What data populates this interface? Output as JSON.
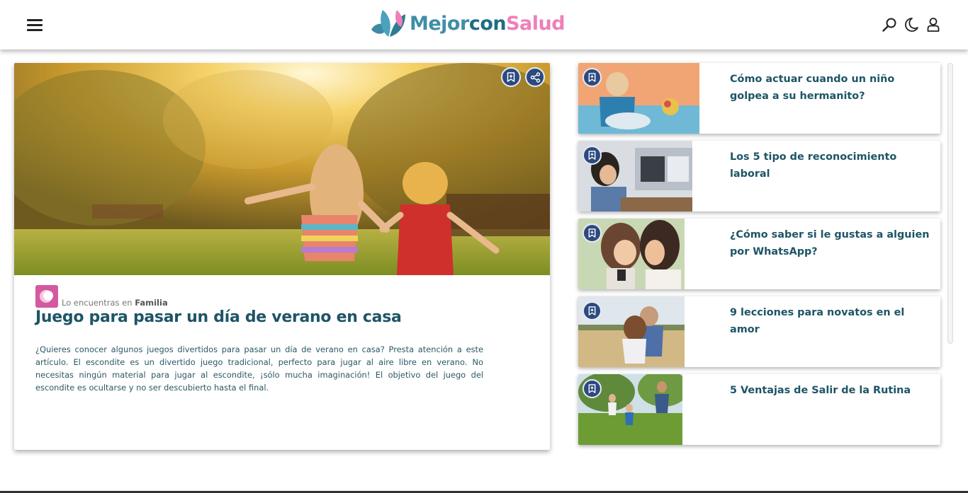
{
  "header": {
    "logo": {
      "part1": "Mejor",
      "part2": "con",
      "part3": "Salud"
    },
    "icons": [
      "search-icon",
      "moon-icon",
      "user-icon"
    ]
  },
  "feature": {
    "category_prefix": "Lo encuentras en",
    "category": "Familia",
    "title": "Juego para pasar un día de verano en casa",
    "description": "¿Quieres conocer algunos juegos divertidos para pasar un día de verano en casa? Presta atención a este artículo. El escondite es un divertido juego tradicional, perfecto para jugar al aire libre en verano. No necesitas ningún material para jugar al escondite, ¡sólo mucha imaginación! El objetivo del juego del escondite es ocultarse y no ser descubierto hasta el final.",
    "image_description": "two girls running in sunny park"
  },
  "side_articles": [
    {
      "title": "Cómo actuar cuando un niño golpea a su hermanito?"
    },
    {
      "title": "Los 5 tipo de reconocimiento laboral"
    },
    {
      "title": "¿Cómo saber si le gustas a alguien por WhatsApp?"
    },
    {
      "title": "9 lecciones para novatos en el amor"
    },
    {
      "title": "5 Ventajas de Salir de la Rutina"
    }
  ],
  "colors": {
    "title": "#1d5566",
    "button": "#2c4a7f",
    "logo_blue": "#3f8ea6",
    "logo_pink": "#ee80b8",
    "category": "#d35a9f"
  }
}
